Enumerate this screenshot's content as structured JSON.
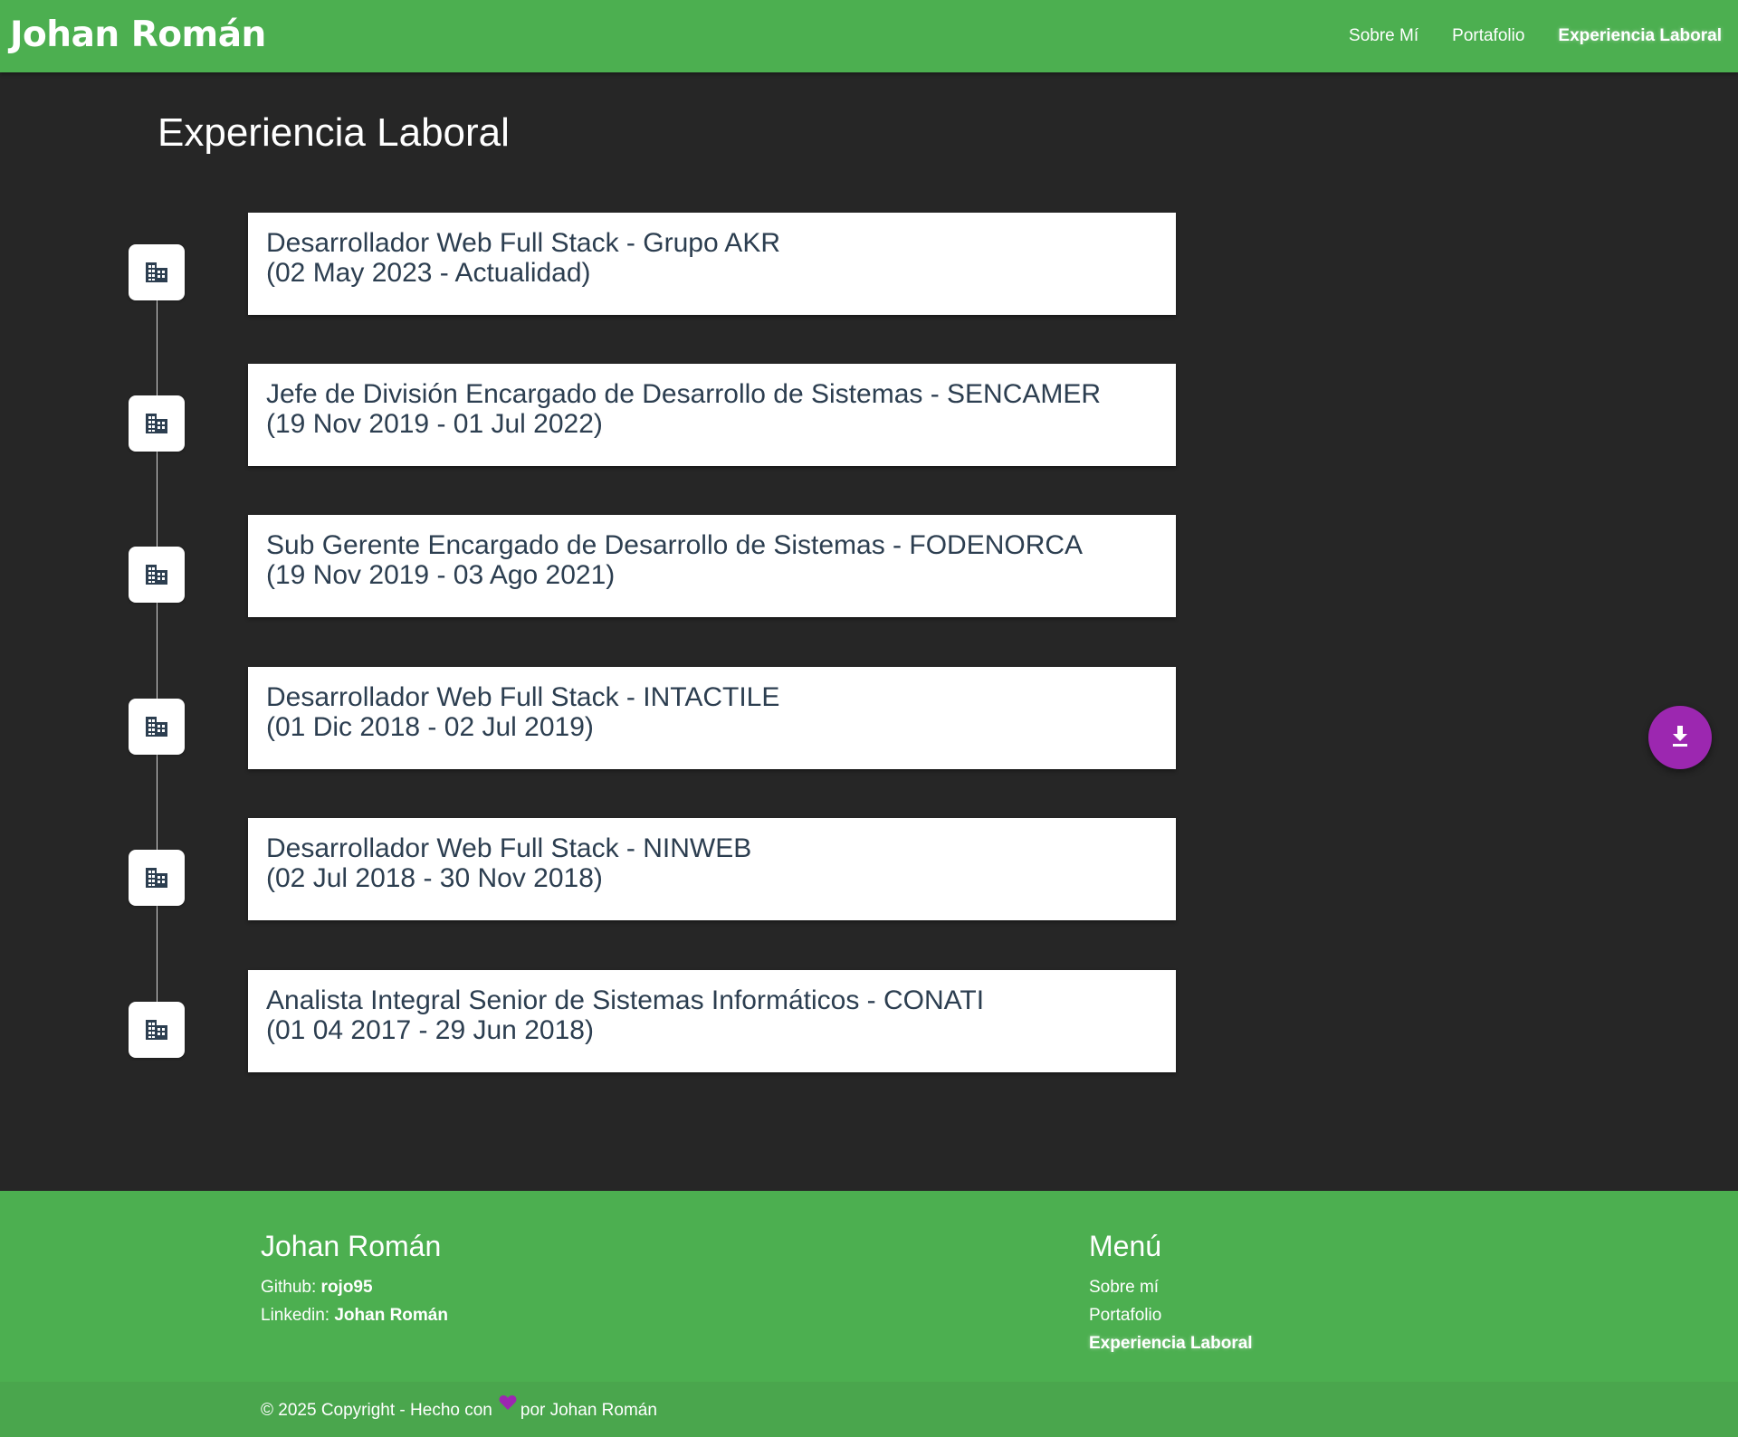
{
  "header": {
    "brand": "Johan Román",
    "nav": [
      "Sobre Mí",
      "Portafolio",
      "Experiencia Laboral"
    ],
    "active_nav": "Experiencia Laboral",
    "color": "#4caf50"
  },
  "main": {
    "title": "Experiencia Laboral",
    "background": "#262626",
    "icon": "building-icon",
    "experiences": [
      {
        "title": "Desarrollador Web Full Stack  - Grupo AKR",
        "period": "(02 May 2023 - Actualidad)"
      },
      {
        "title": "Jefe de División Encargado de Desarrollo de Sistemas  - SENCAMER",
        "period": "(19 Nov 2019 - 01 Jul 2022)"
      },
      {
        "title": "Sub Gerente Encargado de Desarrollo de Sistemas  - FODENORCA",
        "period": "(19 Nov 2019 - 03 Ago 2021)"
      },
      {
        "title": "Desarrollador Web Full Stack  - INTACTILE",
        "period": "(01 Dic 2018 - 02 Jul 2019)"
      },
      {
        "title": "Desarrollador Web Full Stack  - NINWEB",
        "period": "(02 Jul 2018 - 30 Nov 2018)"
      },
      {
        "title": "Analista Integral Senior de Sistemas Informáticos  - CONATI",
        "period": "(01 04 2017 - 29 Jun 2018)"
      }
    ]
  },
  "fab": {
    "icon": "download-icon",
    "color": "#9c27b0"
  },
  "footer": {
    "left": {
      "title": "Johan Román",
      "github_label": "Github: ",
      "github_value": "rojo95",
      "linkedin_label": "Linkedin: ",
      "linkedin_value": "Johan Román"
    },
    "right": {
      "title": "Menú",
      "links": [
        "Sobre mí",
        "Portafolio",
        "Experiencia Laboral"
      ]
    },
    "copyright_prefix": "© 2025 Copyright - Hecho con",
    "copyright_suffix": "por Johan Román",
    "heart_color": "#9c27b0"
  }
}
